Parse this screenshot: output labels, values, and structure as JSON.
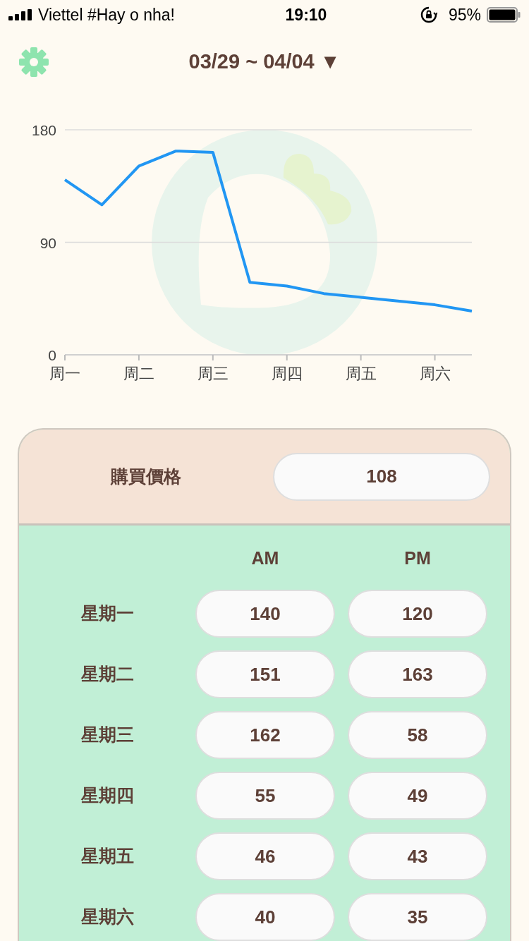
{
  "status_bar": {
    "carrier": "Viettel #Hay o nha!",
    "time": "19:10",
    "battery": "95%"
  },
  "header": {
    "date_range": "03/29 ~ 04/04",
    "dropdown": "▼"
  },
  "chart_data": {
    "type": "line",
    "categories": [
      "周一",
      null,
      "周二",
      null,
      "周三",
      null,
      "周四",
      null,
      "周五",
      null,
      "周六",
      null
    ],
    "ylim": [
      0,
      180
    ],
    "yticks": [
      0,
      90,
      180
    ],
    "series": [
      {
        "color": "#2196f3",
        "values": [
          140,
          120,
          151,
          163,
          162,
          58,
          55,
          49,
          46,
          43,
          40,
          35
        ]
      }
    ]
  },
  "purchase": {
    "label": "購買價格",
    "value": "108"
  },
  "table": {
    "columns": [
      "AM",
      "PM"
    ],
    "rows": [
      {
        "day": "星期一",
        "am": "140",
        "pm": "120"
      },
      {
        "day": "星期二",
        "am": "151",
        "pm": "163"
      },
      {
        "day": "星期三",
        "am": "162",
        "pm": "58"
      },
      {
        "day": "星期四",
        "am": "55",
        "pm": "49"
      },
      {
        "day": "星期五",
        "am": "46",
        "pm": "43"
      },
      {
        "day": "星期六",
        "am": "40",
        "pm": "35"
      }
    ]
  }
}
